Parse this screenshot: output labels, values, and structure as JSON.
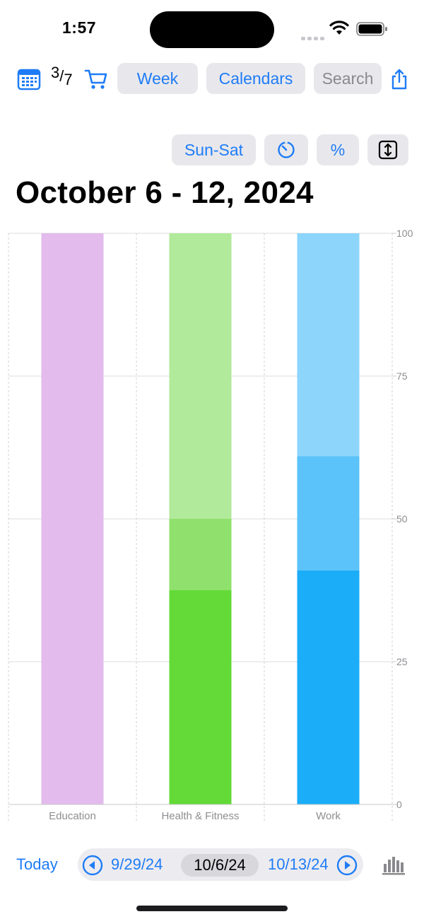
{
  "status_bar": {
    "time": "1:57"
  },
  "toolbar": {
    "fraction_num": "3",
    "fraction_den": "7",
    "week_label": "Week",
    "calendars_label": "Calendars",
    "search_placeholder": "Search"
  },
  "controls": {
    "range_label": "Sun-Sat",
    "percent_label": "%"
  },
  "page_title": "October 6 - 12, 2024",
  "bottom_nav": {
    "today_label": "Today",
    "prev_date": "9/29/24",
    "current_date": "10/6/24",
    "next_date": "10/13/24"
  },
  "chart_data": {
    "type": "bar",
    "stacked": true,
    "title": "",
    "xlabel": "",
    "ylabel": "",
    "categories": [
      "Education",
      "Health & Fitness",
      "Work"
    ],
    "ylim": [
      0,
      100
    ],
    "yticks": [
      0,
      25,
      50,
      75,
      100
    ],
    "y_axis_side": "right",
    "grid": true,
    "legend": "none",
    "bars": [
      {
        "category": "Education",
        "segments": [
          {
            "value": 100,
            "color": "#e3bbed"
          }
        ]
      },
      {
        "category": "Health & Fitness",
        "segments": [
          {
            "value": 37.5,
            "color": "#63da38"
          },
          {
            "value": 12.5,
            "color": "#8fe06c"
          },
          {
            "value": 50,
            "color": "#b1ea9a"
          }
        ]
      },
      {
        "category": "Work",
        "segments": [
          {
            "value": 41,
            "color": "#1badf8"
          },
          {
            "value": 20,
            "color": "#5bc3f9"
          },
          {
            "value": 39,
            "color": "#8dd5fb"
          }
        ]
      }
    ]
  },
  "colors": {
    "accent": "#1f7cf6",
    "button_bg": "#e8e8ec"
  }
}
